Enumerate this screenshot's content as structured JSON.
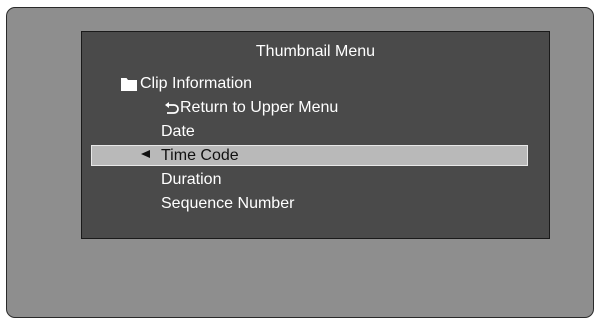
{
  "menu": {
    "title": "Thumbnail Menu",
    "folder": {
      "label": "Clip Information",
      "icon": "folder-icon"
    },
    "items": [
      {
        "label": "Return to Upper Menu",
        "icon": "return-arrow-icon",
        "selected": false
      },
      {
        "label": "Date",
        "selected": false
      },
      {
        "label": "Time Code",
        "selected": true,
        "icon": "selection-pointer-icon"
      },
      {
        "label": "Duration",
        "selected": false
      },
      {
        "label": "Sequence Number",
        "selected": false
      }
    ]
  },
  "colors": {
    "screen_background": "#8e8e8e",
    "panel_background": "#4a4a4a",
    "highlight": "#b9b9b9",
    "text": "#ffffff",
    "selected_text": "#111111"
  }
}
